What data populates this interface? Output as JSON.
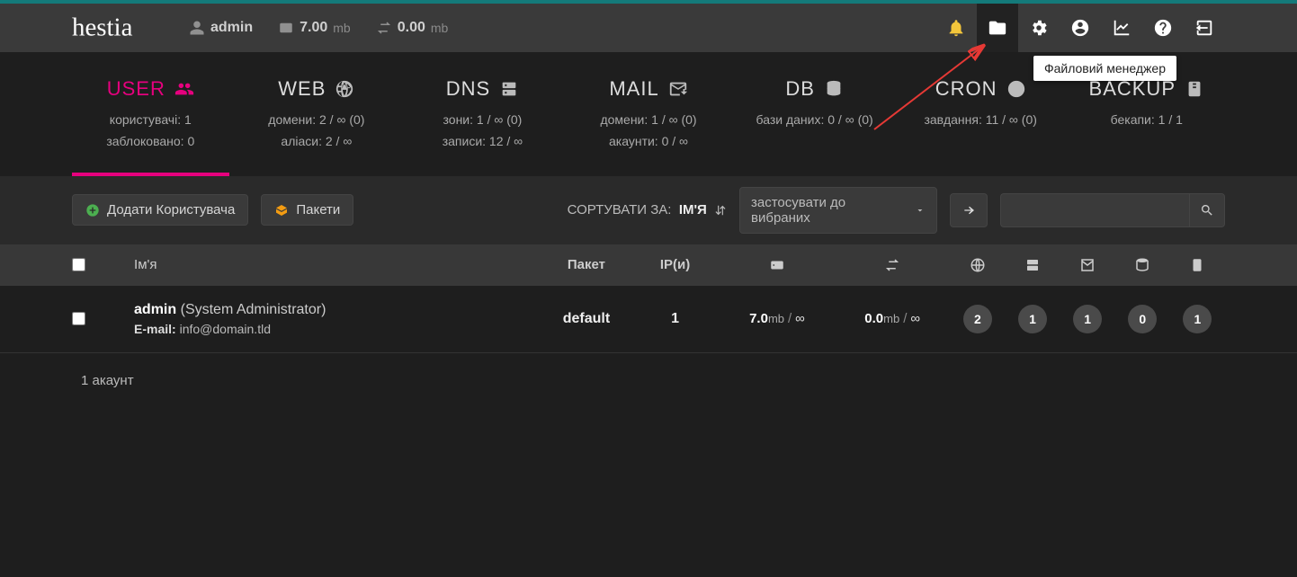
{
  "topbar": {
    "logo": "hestia",
    "user_label": "admin",
    "disk_val": "7.00",
    "disk_unit": "mb",
    "bw_val": "0.00",
    "bw_unit": "mb",
    "tooltip": "Файловий менеджер"
  },
  "tabs": {
    "user": {
      "title": "USER",
      "line1": "користувачі: 1",
      "line2": "заблоковано: 0"
    },
    "web": {
      "title": "WEB",
      "line1": "домени: 2 / ∞ (0)",
      "line2": "аліаси: 2 / ∞"
    },
    "dns": {
      "title": "DNS",
      "line1": "зони: 1 / ∞ (0)",
      "line2": "записи: 12 / ∞"
    },
    "mail": {
      "title": "MAIL",
      "line1": "домени: 1 / ∞ (0)",
      "line2": "акаунти: 0 / ∞"
    },
    "db": {
      "title": "DB",
      "line1": "бази даних: 0 / ∞ (0)",
      "line2": ""
    },
    "cron": {
      "title": "CRON",
      "line1": "завдання: 11 / ∞ (0)",
      "line2": ""
    },
    "backup": {
      "title": "BACKUP",
      "line1": "бекапи: 1 / 1",
      "line2": ""
    }
  },
  "toolbar": {
    "add_user": "Додати Користувача",
    "packages": "Пакети",
    "sort_label": "СОРТУВАТИ ЗА:",
    "sort_value": "ІМ'Я",
    "select": "застосувати до вибраних"
  },
  "table": {
    "head": {
      "name": "Ім'я",
      "pkg": "Пакет",
      "ip": "IP(и)"
    },
    "row": {
      "uname": "admin",
      "role": "(System Administrator)",
      "email_label": "E-mail:",
      "email": "info@domain.tld",
      "pkg": "default",
      "ip": "1",
      "disk_v": "7.0",
      "disk_u": "mb",
      "disk_lim": "∞",
      "bw_v": "0.0",
      "bw_u": "mb",
      "bw_lim": "∞",
      "c1": "2",
      "c2": "1",
      "c3": "1",
      "c4": "0",
      "c5": "1"
    },
    "summary": "1 акаунт"
  }
}
